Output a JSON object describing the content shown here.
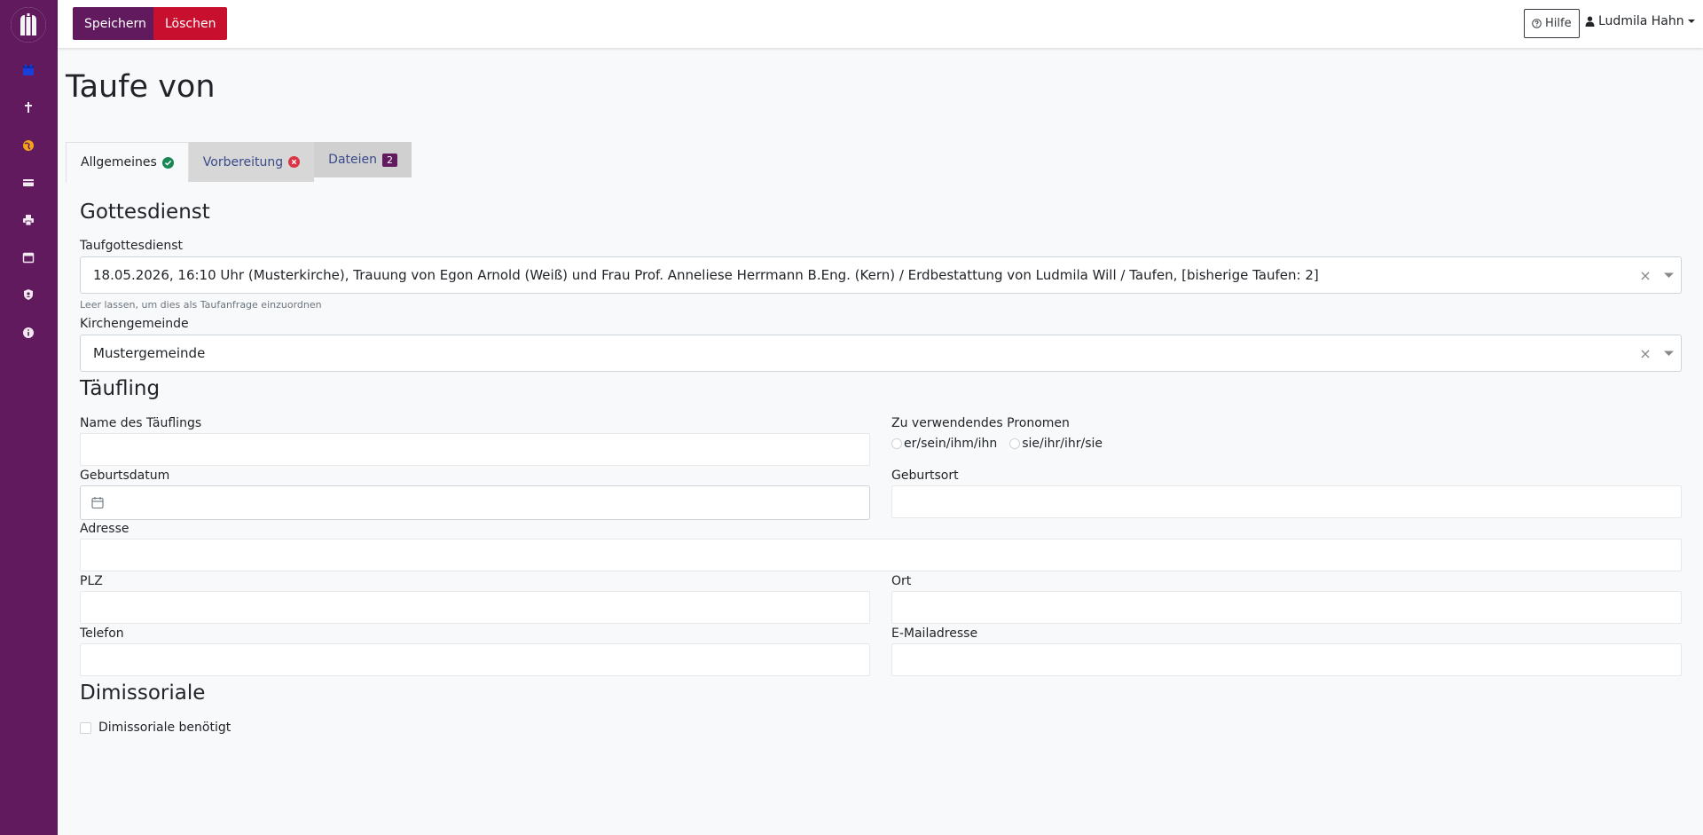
{
  "sidebar": {
    "logo": "church-logo",
    "items": [
      {
        "icon": "calendar-icon",
        "color": "#1a3fd6"
      },
      {
        "icon": "cross-icon",
        "color": "#f3e9f3"
      },
      {
        "icon": "globe-icon",
        "color": "#f4a21b"
      },
      {
        "icon": "card-icon",
        "color": "#f3e9f3"
      },
      {
        "icon": "printer-icon",
        "color": "#f3e9f3"
      },
      {
        "icon": "calendar-alt-icon",
        "color": "#f3e9f3"
      },
      {
        "icon": "user-shield-icon",
        "color": "#f3e9f3"
      },
      {
        "icon": "info-icon",
        "color": "#f3e9f3"
      }
    ]
  },
  "toolbar": {
    "save_label": "Speichern",
    "delete_label": "Löschen",
    "help_label": "Hilfe",
    "user_name": "Ludmila Hahn"
  },
  "page": {
    "title": "Taufe von"
  },
  "tabs": [
    {
      "label": "Allgemeines",
      "status": "ok"
    },
    {
      "label": "Vorbereitung",
      "status": "error"
    },
    {
      "label": "Dateien",
      "badge": "2"
    }
  ],
  "gottesdienst": {
    "heading": "Gottesdienst",
    "service_label": "Taufgottesdienst",
    "service_value": "18.05.2026, 16:10 Uhr (Musterkirche), Trauung von Egon Arnold (Weiß) und Frau Prof. Anneliese Herrmann B.Eng. (Kern) / Erdbestattung von Ludmila Will / Taufen, [bisherige Taufen: 2]",
    "service_hint": "Leer lassen, um dies als Taufanfrage einzuordnen",
    "parish_label": "Kirchengemeinde",
    "parish_value": "Mustergemeinde"
  },
  "taeufling": {
    "heading": "Täufling",
    "name_label": "Name des Täuflings",
    "pronoun_label": "Zu verwendendes Pronomen",
    "pronoun_options": [
      "er/sein/ihm/ihn",
      "sie/ihr/ihr/sie"
    ],
    "birthdate_label": "Geburtsdatum",
    "birthplace_label": "Geburtsort",
    "address_label": "Adresse",
    "zip_label": "PLZ",
    "city_label": "Ort",
    "phone_label": "Telefon",
    "email_label": "E-Mailadresse"
  },
  "dimissoriale": {
    "heading": "Dimissoriale",
    "checkbox_label": "Dimissoriale benötigt"
  },
  "colors": {
    "brand": "#611a5e",
    "danger": "#c8102e"
  }
}
